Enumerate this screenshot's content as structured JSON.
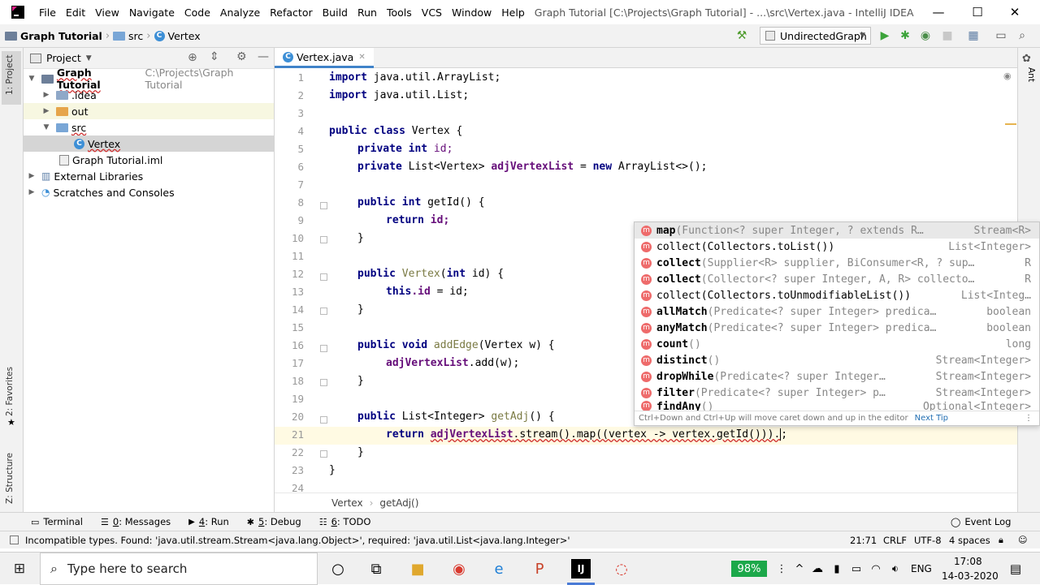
{
  "window": {
    "menu": [
      "File",
      "Edit",
      "View",
      "Navigate",
      "Code",
      "Analyze",
      "Refactor",
      "Build",
      "Run",
      "Tools",
      "VCS",
      "Window",
      "Help"
    ],
    "title": "Graph Tutorial [C:\\Projects\\Graph Tutorial] - ...\\src\\Vertex.java - IntelliJ IDEA",
    "controls": {
      "minimize": "—",
      "maximize": "☐",
      "close": "✕"
    }
  },
  "navbar": {
    "crumbs": [
      "Graph Tutorial",
      "src",
      "Vertex"
    ],
    "run_config": "UndirectedGraph"
  },
  "left_strip": {
    "project": "1: Project",
    "favorites": "2: Favorites",
    "structure": "Z: Structure"
  },
  "right_strip": {
    "ant": "Ant"
  },
  "project_panel": {
    "header": "Project",
    "tree": [
      {
        "label": "Graph Tutorial",
        "extra": "C:\\Projects\\Graph Tutorial"
      },
      {
        "label": ".idea"
      },
      {
        "label": "out"
      },
      {
        "label": "src"
      },
      {
        "label": "Vertex"
      },
      {
        "label": "Graph Tutorial.iml"
      },
      {
        "label": "External Libraries"
      },
      {
        "label": "Scratches and Consoles"
      }
    ]
  },
  "editor": {
    "tab": "Vertex.java",
    "line_numbers": [
      "1",
      "2",
      "3",
      "4",
      "5",
      "6",
      "7",
      "8",
      "9",
      "10",
      "11",
      "12",
      "13",
      "14",
      "15",
      "16",
      "17",
      "18",
      "19",
      "20",
      "21",
      "22",
      "23",
      "24"
    ],
    "code": {
      "l1a": "import",
      "l1b": " java.util.ArrayList;",
      "l2a": "import",
      "l2b": " java.util.List;",
      "l4a": "public class",
      "l4b": " Vertex {",
      "l5a": "private int",
      "l5b": " id;",
      "l6a": "private",
      "l6b": " List<Vertex> ",
      "l6c": "adjVertexList",
      "l6d": " = ",
      "l6e": "new",
      "l6f": " ArrayList<>();",
      "l8a": "public int",
      "l8b": " getId",
      "l8c": "() {",
      "l9a": "return",
      "l9b": " id;",
      "l10": "}",
      "l12a": "public",
      "l12b": " Vertex",
      "l12c": "(",
      "l12d": "int",
      "l12e": " id) {",
      "l13a": "this",
      "l13b": ".id",
      "l13c": " = id;",
      "l14": "}",
      "l16a": "public void",
      "l16b": " addEdge",
      "l16c": "(Vertex w) {",
      "l17a": "adjVertexList",
      "l17b": ".add(w);",
      "l18": "}",
      "l20a": "public",
      "l20b": " List<Integer> ",
      "l20c": "getAdj",
      "l20d": "() {",
      "l21a": "return",
      "l21b": "adjVertexList",
      "l21c": ".stream().map((vertex -> vertex.getId())).",
      "l21d": ";",
      "l22": "}",
      "l23": "}"
    },
    "breadcrumb": [
      "Vertex",
      "getAdj()"
    ]
  },
  "completion": {
    "items": [
      {
        "name": "map",
        "params": "(Function<? super Integer, ? extends R…",
        "type": "Stream<R>"
      },
      {
        "name": "collect(Collectors.toList())",
        "params": "",
        "type": "List<Integer>"
      },
      {
        "name": "collect",
        "params": "(Supplier<R> supplier, BiConsumer<R, ? sup…",
        "type": "R"
      },
      {
        "name": "collect",
        "params": "(Collector<? super Integer, A, R> collecto…",
        "type": "R"
      },
      {
        "name": "collect(Collectors.toUnmodifiableList())",
        "params": "",
        "type": "List<Integ…"
      },
      {
        "name": "allMatch",
        "params": "(Predicate<? super Integer> predica…",
        "type": "boolean"
      },
      {
        "name": "anyMatch",
        "params": "(Predicate<? super Integer> predica…",
        "type": "boolean"
      },
      {
        "name": "count",
        "params": "()",
        "type": "long"
      },
      {
        "name": "distinct",
        "params": "()",
        "type": "Stream<Integer>"
      },
      {
        "name": "dropWhile",
        "params": "(Predicate<? super Integer…",
        "type": "Stream<Integer>"
      },
      {
        "name": "filter",
        "params": "(Predicate<? super Integer> p…",
        "type": "Stream<Integer>"
      },
      {
        "name": "findAny",
        "params": "()",
        "type": "Optional<Integer>"
      }
    ],
    "tip": "Ctrl+Down and Ctrl+Up will move caret down and up in the editor",
    "next_tip": "Next Tip",
    "item_icon": "m"
  },
  "bottom_tools": [
    {
      "label": "Terminal"
    },
    {
      "key": "0",
      "label": ": Messages"
    },
    {
      "key": "4",
      "label": ": Run"
    },
    {
      "key": "5",
      "label": ": Debug"
    },
    {
      "key": "6",
      "label": ": TODO"
    }
  ],
  "event_log": "Event Log",
  "status": {
    "message": "Incompatible types. Found: 'java.util.stream.Stream<java.lang.Object>', required: 'java.util.List<java.lang.Integer>'",
    "position": "21:71",
    "line_sep": "CRLF",
    "encoding": "UTF-8",
    "indent": "4 spaces"
  },
  "taskbar": {
    "search_placeholder": "Type here to search",
    "battery": "98%",
    "lang": "ENG",
    "time": "17:08",
    "date": "14-03-2020"
  }
}
